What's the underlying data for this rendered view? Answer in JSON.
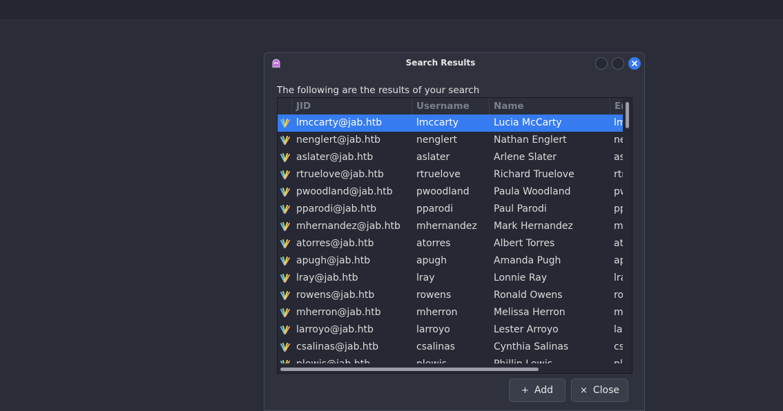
{
  "dialog": {
    "title": "Search Results",
    "intro": "The following are the results of your search"
  },
  "table": {
    "columns": [
      "JID",
      "Username",
      "Name",
      "Email"
    ],
    "column_visible": [
      "JID",
      "Username",
      "Name",
      "Er"
    ],
    "rows": [
      {
        "jid": "lmccarty@jab.htb",
        "username": "lmccarty",
        "name": "Lucia McCarty",
        "email": "lm",
        "selected": true
      },
      {
        "jid": "nenglert@jab.htb",
        "username": "nenglert",
        "name": "Nathan Englert",
        "email": "ne"
      },
      {
        "jid": "aslater@jab.htb",
        "username": "aslater",
        "name": "Arlene Slater",
        "email": "as"
      },
      {
        "jid": "rtruelove@jab.htb",
        "username": "rtruelove",
        "name": "Richard Truelove",
        "email": "rtr"
      },
      {
        "jid": "pwoodland@jab.htb",
        "username": "pwoodland",
        "name": "Paula Woodland",
        "email": "pw"
      },
      {
        "jid": "pparodi@jab.htb",
        "username": "pparodi",
        "name": "Paul Parodi",
        "email": "pp"
      },
      {
        "jid": "mhernandez@jab.htb",
        "username": "mhernandez",
        "name": "Mark Hernandez",
        "email": "m"
      },
      {
        "jid": "atorres@jab.htb",
        "username": "atorres",
        "name": "Albert Torres",
        "email": "at"
      },
      {
        "jid": "apugh@jab.htb",
        "username": "apugh",
        "name": "Amanda Pugh",
        "email": "ap"
      },
      {
        "jid": "lray@jab.htb",
        "username": "lray",
        "name": "Lonnie Ray",
        "email": "lra"
      },
      {
        "jid": "rowens@jab.htb",
        "username": "rowens",
        "name": "Ronald Owens",
        "email": "ro"
      },
      {
        "jid": "mherron@jab.htb",
        "username": "mherron",
        "name": "Melissa Herron",
        "email": "m"
      },
      {
        "jid": "larroyo@jab.htb",
        "username": "larroyo",
        "name": "Lester Arroyo",
        "email": "la"
      },
      {
        "jid": "csalinas@jab.htb",
        "username": "csalinas",
        "name": "Cynthia Salinas",
        "email": "cs"
      },
      {
        "jid": "plewis@jab.htb",
        "username": "plewis",
        "name": "Phillip Lewis",
        "email": "pl"
      }
    ]
  },
  "buttons": {
    "add": {
      "glyph": "+",
      "label": "Add"
    },
    "close": {
      "glyph": "×",
      "label": "Close"
    }
  },
  "colors": {
    "accent": "#367bf0",
    "background": "#2a2c38",
    "dialog": "#2f323d"
  },
  "icons": {
    "app": "ghost-app-icon",
    "row": "contact-icon"
  }
}
